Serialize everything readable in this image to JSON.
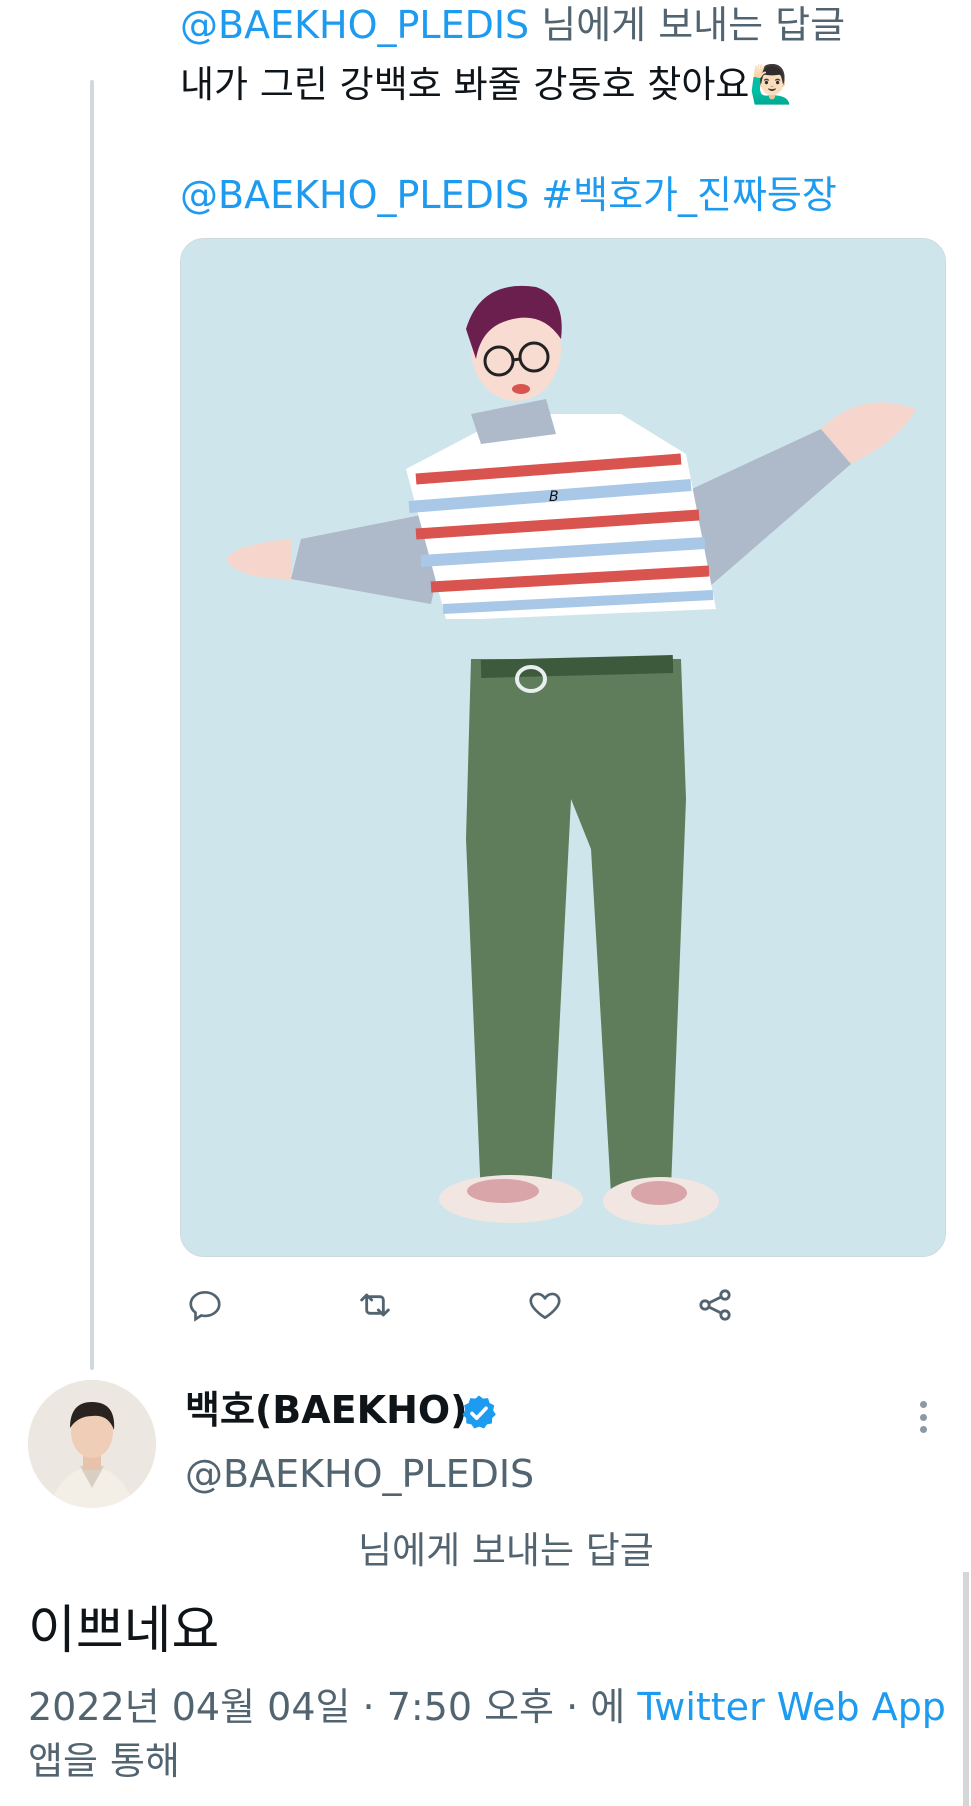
{
  "parent_tweet": {
    "replying_to": {
      "mention": "@BAEKHO_PLEDIS",
      "suffix": "님에게 보내는 답글"
    },
    "text": "내가 그린 강백호 봐줄 강동호 찾아요",
    "emoji": "🙋🏻‍♂️",
    "tag_mention": "@BAEKHO_PLEDIS",
    "hashtag": "#백호가_진짜등장",
    "image_icon": "illustration-of-person-in-striped-sweater"
  },
  "actions": [
    {
      "name": "reply",
      "icon": "comment-icon"
    },
    {
      "name": "retweet",
      "icon": "retweet-icon"
    },
    {
      "name": "like",
      "icon": "heart-icon"
    },
    {
      "name": "share",
      "icon": "share-icon"
    }
  ],
  "reply_tweet": {
    "display_name": "백호(BAEKHO)",
    "handle": "@BAEKHO_PLEDIS",
    "replying_label": "님에게 보내는 답글",
    "text": "이쁘네요",
    "timestamp": "2022년 04월 04일 · 7:50 오후 · 에",
    "source": "Twitter Web App",
    "source_suffix": "앱을 통해"
  },
  "colors": {
    "accent": "#1d9bf0",
    "secondary_text": "#536471",
    "verified": "#1d9bf0"
  }
}
